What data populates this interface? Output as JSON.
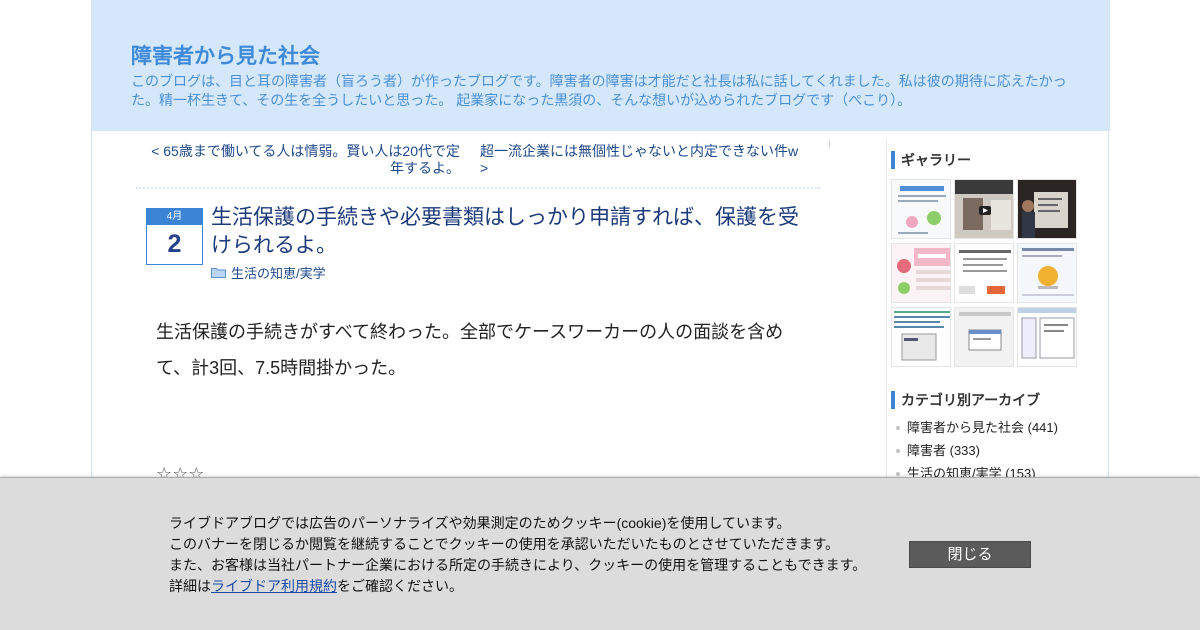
{
  "header": {
    "title": "障害者から見た社会",
    "description": "このブログは、目と耳の障害者（盲ろう者）が作ったブログです。障害者の障害は才能だと社長は私に話してくれました。私は彼の期待に応えたかった。精一杯生きて、その生を全うしたいと思った。 起業家になった黒須の、そんな想いが込められたブログです（ぺこり）。"
  },
  "pager": {
    "prev": "< 65歳まで働いてる人は情弱。賢い人は20代で定年するよ。",
    "next": "超一流企業には無個性じゃないと内定できない件w >"
  },
  "article": {
    "month": "4月",
    "day": "2",
    "title": "生活保護の手続きや必要書類はしっかり申請すれば、保護を受けられるよ。",
    "category": "生活の知恵/実学",
    "body": "生活保護の手続きがすべて終わった。全部でケースワーカーの人の面談を含めて、計3回、7.5時間掛かった。",
    "stars": "☆☆☆"
  },
  "sidebar": {
    "gallery_heading": "ギャラリー",
    "archive_heading": "カテゴリ別アーカイブ",
    "categories": [
      "障害者から見た社会 (441)",
      "障害者 (333)",
      "生活の知恵/実学 (153)"
    ]
  },
  "cookie": {
    "line1": "ライブドアブログでは広告のパーソナライズや効果測定のためクッキー(cookie)を使用しています。",
    "line2": "このバナーを閉じるか閲覧を継続することでクッキーの使用を承認いただいたものとさせていただきます。",
    "line3": "また、お客様は当社パートナー企業における所定の手続きにより、クッキーの使用を管理することもできます。",
    "line4_prefix": "詳細は",
    "line4_link": "ライブドア利用規約",
    "line4_suffix": "をご確認ください。",
    "close_label": "閉じる"
  },
  "colors": {
    "header_bg": "#d5e7fb",
    "title_blue": "#3e8ad8",
    "link_navy": "#1f4a8a",
    "accent": "#3b84d6",
    "banner_bg": "#dcdcdc",
    "close_btn": "#5b5b5b"
  }
}
